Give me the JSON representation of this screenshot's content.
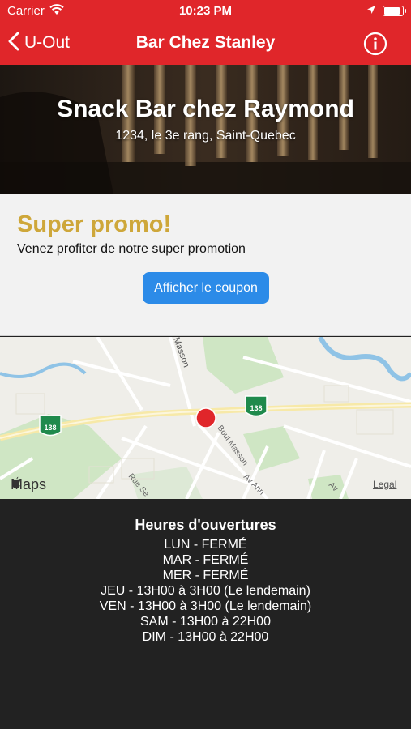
{
  "status_bar": {
    "carrier": "Carrier",
    "time": "10:23 PM",
    "battery_level": 0.9
  },
  "nav": {
    "back_label": "U-Out",
    "title": "Bar Chez Stanley",
    "info_icon": "info-circle-icon",
    "back_icon": "chevron-left-icon"
  },
  "venue": {
    "name": "Snack Bar chez Raymond",
    "address": "1234, le 3e rang, Saint-Quebec"
  },
  "promo": {
    "title": "Super promo!",
    "text": "Venez profiter de notre super promotion",
    "button_label": "Afficher le coupon"
  },
  "map": {
    "logo": "Maps",
    "legal": "Legal",
    "streets": [
      "Masson",
      "Boul Masson",
      "Rue Sé",
      "Av Ann",
      "Av"
    ],
    "route_shields": [
      "138",
      "138"
    ]
  },
  "hours": {
    "title": "Heures d'ouvertures",
    "items": [
      "LUN - FERMÉ",
      "MAR - FERMÉ",
      "MER - FERMÉ",
      "JEU - 13H00 à 3H00 (Le lendemain)",
      "VEN - 13H00 à 3H00 (Le lendemain)",
      "SAM - 13H00 à 22H00",
      "DIM - 13H00 à 22H00"
    ]
  },
  "colors": {
    "accent": "#e0262a",
    "promo_title": "#cea73a",
    "button": "#2c8be8",
    "map_pin": "#e0262a",
    "footer_bg": "#222222"
  }
}
